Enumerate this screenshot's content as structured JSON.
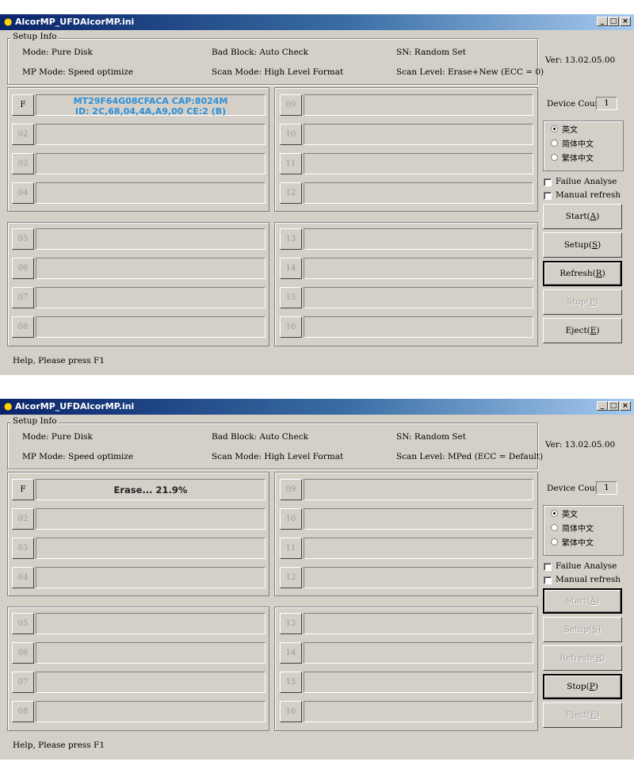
{
  "windows": [
    {
      "title": "AlcorMP_UFD",
      "ini": "AlcorMP.ini",
      "setup_label": "Setup Info",
      "mode": "Mode: Pure Disk",
      "bad_block": "Bad Block: Auto Check",
      "sn": "SN: Random Set",
      "mp_mode": "MP Mode: Speed optimize",
      "scan_mode": "Scan Mode: High Level Format",
      "scan_level": "Scan Level: Erase+New (ECC = 0)",
      "version": "Ver: 13.02.05.00",
      "device_count_label": "Device Count:",
      "device_count": "1",
      "slots": {
        "s1": "F",
        "s2": "02",
        "s3": "03",
        "s4": "04",
        "s5": "05",
        "s6": "06",
        "s7": "07",
        "s8": "08",
        "s9": "09",
        "s10": "10",
        "s11": "11",
        "s12": "12",
        "s13": "13",
        "s14": "14",
        "s15": "15",
        "s16": "16"
      },
      "slot1_line1": "MT29F64G08CFACA CAP:8024M",
      "slot1_line2": "ID: 2C,68,04,4A,A9,00  CE:2 (B)",
      "languages": [
        "英文",
        "简体中文",
        "繁体中文"
      ],
      "selected_language": "英文",
      "failure_analyse": "Failue Analyse",
      "manual_refresh": "Manual refresh",
      "buttons": {
        "start": "Start(",
        "start_key": "A",
        "setup": "Setup(",
        "setup_key": "S",
        "refresh": "Refresh(",
        "refresh_key": "R",
        "stop": "Stop(",
        "stop_key": "P",
        "eject": "Eject(",
        "eject_key": "E",
        "close": ")"
      },
      "status": "Help, Please press F1"
    },
    {
      "title": "AlcorMP_UFD",
      "ini": "AlcorMP.ini",
      "setup_label": "Setup Info",
      "mode": "Mode: Pure Disk",
      "bad_block": "Bad Block: Auto Check",
      "sn": "SN: Random Set",
      "mp_mode": "MP Mode: Speed optimize",
      "scan_mode": "Scan Mode: High Level Format",
      "scan_level": "Scan Level: MPed (ECC = Default)",
      "version": "Ver: 13.02.05.00",
      "device_count_label": "Device Count:",
      "device_count": "1",
      "slots": {
        "s1": "F",
        "s2": "02",
        "s3": "03",
        "s4": "04",
        "s5": "05",
        "s6": "06",
        "s7": "07",
        "s8": "08",
        "s9": "09",
        "s10": "10",
        "s11": "11",
        "s12": "12",
        "s13": "13",
        "s14": "14",
        "s15": "15",
        "s16": "16"
      },
      "slot1_progress": "Erase... 21.9%",
      "languages": [
        "英文",
        "简体中文",
        "繁体中文"
      ],
      "selected_language": "英文",
      "failure_analyse": "Failue Analyse",
      "manual_refresh": "Manual refresh",
      "buttons": {
        "start": "Start(",
        "start_key": "A",
        "setup": "Setup(",
        "setup_key": "S",
        "refresh": "Refresh(",
        "refresh_key": "R",
        "stop": "Stop(",
        "stop_key": "P",
        "eject": "Eject(",
        "eject_key": "E",
        "close": ")"
      },
      "status": "Help, Please press F1"
    }
  ]
}
